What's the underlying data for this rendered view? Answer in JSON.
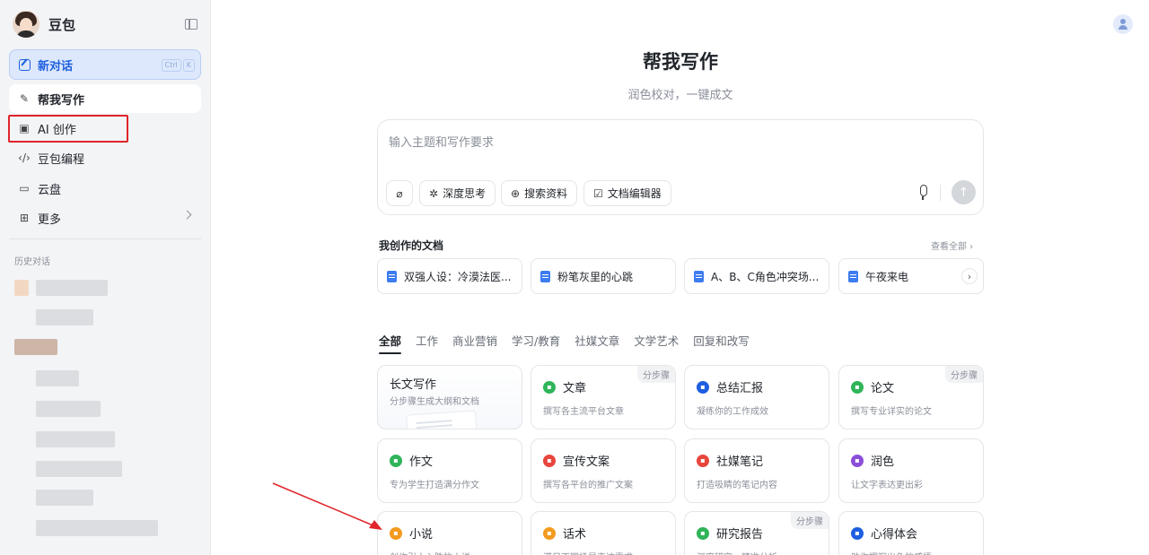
{
  "sidebar": {
    "brand_name": "豆包",
    "new_chat": {
      "label": "新对话",
      "kbd": [
        "Ctrl",
        "K"
      ]
    },
    "items": [
      {
        "label": "帮我写作",
        "icon": "pen-sparkle-icon",
        "active": true
      },
      {
        "label": "AI 创作",
        "icon": "image-edit-icon",
        "active": false
      },
      {
        "label": "豆包编程",
        "icon": "code-icon",
        "active": false
      },
      {
        "label": "云盘",
        "icon": "cloud-folder-icon",
        "active": false
      },
      {
        "label": "更多",
        "icon": "grid-icon",
        "active": false
      }
    ],
    "history_title": "历史对话"
  },
  "main": {
    "title": "帮我写作",
    "subtitle": "润色校对，一键成文",
    "composer": {
      "placeholder": "输入主题和写作要求",
      "chips": [
        {
          "label": "深度思考",
          "icon": "atom-icon"
        },
        {
          "label": "搜索资料",
          "icon": "globe-icon"
        },
        {
          "label": "文档编辑器",
          "icon": "doc-edit-icon"
        }
      ]
    },
    "docs": {
      "title": "我创作的文档",
      "more": "查看全部",
      "items": [
        "双强人设：冷漠法医...",
        "粉笔灰里的心跳",
        "A、B、C角色冲突场...",
        "午夜来电"
      ]
    },
    "tabs": [
      "全部",
      "工作",
      "商业营销",
      "学习/教育",
      "社媒文章",
      "文学艺术",
      "回复和改写"
    ],
    "cards": [
      {
        "title": "长文写作",
        "desc": "分步骤生成大纲和文档",
        "badge": "",
        "color": ""
      },
      {
        "title": "文章",
        "desc": "撰写各主流平台文章",
        "badge": "分步骤",
        "color": "#2fb45a"
      },
      {
        "title": "总结汇报",
        "desc": "凝练你的工作成效",
        "badge": "",
        "color": "#1d5fe0"
      },
      {
        "title": "论文",
        "desc": "撰写专业详实的论文",
        "badge": "分步骤",
        "color": "#2fb45a"
      },
      {
        "title": "作文",
        "desc": "专为学生打造满分作文",
        "badge": "",
        "color": "#2fb45a"
      },
      {
        "title": "宣传文案",
        "desc": "撰写各平台的推广文案",
        "badge": "",
        "color": "#e8453c"
      },
      {
        "title": "社媒笔记",
        "desc": "打造吸睛的笔记内容",
        "badge": "",
        "color": "#e8453c"
      },
      {
        "title": "润色",
        "desc": "让文字表达更出彩",
        "badge": "",
        "color": "#8a4fd8"
      },
      {
        "title": "小说",
        "desc": "创作引人入胜的小说",
        "badge": "",
        "color": "#f39a1e"
      },
      {
        "title": "话术",
        "desc": "满足不同场景表达需求",
        "badge": "",
        "color": "#f39a1e"
      },
      {
        "title": "研究报告",
        "desc": "深度研究，精准分析",
        "badge": "分步骤",
        "color": "#2fb45a"
      },
      {
        "title": "心得体会",
        "desc": "助你撰写出色的感悟",
        "badge": "",
        "color": "#1d5fe0"
      }
    ]
  }
}
